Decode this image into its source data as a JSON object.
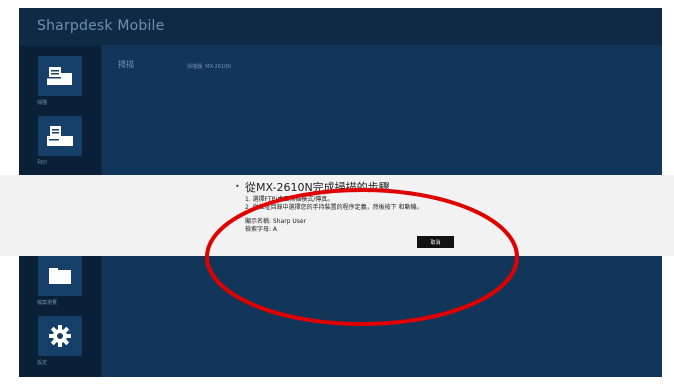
{
  "app": {
    "title": "Sharpdesk Mobile"
  },
  "sidebar": {
    "items": [
      {
        "label": "掃描",
        "icon": "scan-icon"
      },
      {
        "label": "列印",
        "icon": "print-icon"
      },
      {
        "label": "",
        "icon": "refresh-icon"
      },
      {
        "label": "檔案瀏覽",
        "icon": "folder-icon"
      },
      {
        "label": "設定",
        "icon": "gear-icon"
      }
    ]
  },
  "header": {
    "title": "掃描",
    "device": "掃描器: MX-2610N"
  },
  "dialog": {
    "title": "從MX-2610N完成掃描的步驟",
    "steps": [
      "1. 選擇FTP/桌面掃描模式/傳真。",
      "2. 從位址目錄中選擇您的手持裝置的程序定義，然後按下 和動機。"
    ],
    "display_name": "顯示名稱: Sharp User",
    "search_char": "檢索字母: A",
    "cancel_label": "取消"
  },
  "colors": {
    "app_bg": "#0f2a45",
    "sidebar_bg": "#0a2038",
    "content_bg": "#12365a",
    "tile_bg": "#16406a",
    "dialog_bg": "#f2f2f2",
    "annotation_red": "#e00000"
  }
}
